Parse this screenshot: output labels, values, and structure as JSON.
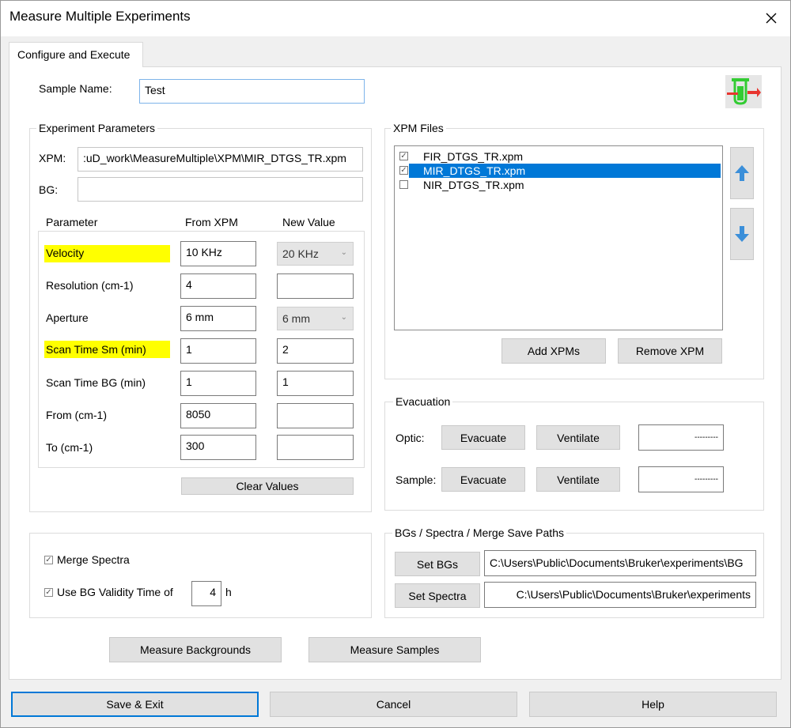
{
  "window": {
    "title": "Measure Multiple Experiments"
  },
  "tabs": [
    {
      "label": "Configure and Execute"
    }
  ],
  "sample": {
    "label": "Sample Name:",
    "value": "Test"
  },
  "experiment": {
    "group_title": "Experiment Parameters",
    "xpm_label": "XPM:",
    "xpm_value": ":uD_work\\MeasureMultiple\\XPM\\MIR_DTGS_TR.xpm",
    "bg_label": "BG:",
    "bg_value": "",
    "headers": {
      "parameter": "Parameter",
      "from": "From XPM",
      "new": "New Value"
    },
    "rows": [
      {
        "name": "Velocity",
        "from": "10 KHz",
        "new": "20 KHz"
      },
      {
        "name": "Resolution (cm-1)",
        "from": "4",
        "new": ""
      },
      {
        "name": "Aperture",
        "from": "6 mm",
        "new": "6 mm"
      },
      {
        "name": "Scan Time Sm (min)",
        "from": "1",
        "new": "2"
      },
      {
        "name": "Scan Time BG (min)",
        "from": "1",
        "new": "1"
      },
      {
        "name": "From (cm-1)",
        "from": "8050",
        "new": ""
      },
      {
        "name": "To (cm-1)",
        "from": "300",
        "new": ""
      }
    ],
    "clear_label": "Clear Values"
  },
  "xpm_files": {
    "group_title": "XPM Files",
    "items": [
      {
        "name": "FIR_DTGS_TR.xpm",
        "checked": true
      },
      {
        "name": "MIR_DTGS_TR.xpm",
        "checked": true
      },
      {
        "name": "NIR_DTGS_TR.xpm",
        "checked": false
      }
    ],
    "add_label": "Add XPMs",
    "remove_label": "Remove XPM"
  },
  "evacuation": {
    "group_title": "Evacuation",
    "optic_label": "Optic:",
    "sample_label": "Sample:",
    "evacuate_label": "Evacuate",
    "ventilate_label": "Ventilate",
    "optic_status": "---------",
    "sample_status": "---------"
  },
  "options": {
    "merge_label": "Merge Spectra",
    "validity_label": "Use BG Validity Time of",
    "validity_value": "4",
    "validity_unit": "h"
  },
  "paths": {
    "group_title": "BGs / Spectra / Merge Save Paths",
    "set_bgs_label": "Set BGs",
    "bgs_path": "C:\\Users\\Public\\Documents\\Bruker\\experiments\\BG",
    "set_spectra_label": "Set Spectra",
    "spectra_path": "C:\\Users\\Public\\Documents\\Bruker\\experiments"
  },
  "actions": {
    "measure_bg_label": "Measure Backgrounds",
    "measure_samples_label": "Measure Samples"
  },
  "footer": {
    "save_label": "Save & Exit",
    "cancel_label": "Cancel",
    "help_label": "Help"
  },
  "colors": {
    "highlight": "#ffff00",
    "selection": "#0078d7",
    "arrow": "#3b8fd9",
    "icon_green": "#33cc33",
    "icon_red": "#e8352f"
  },
  "icons": {
    "close": "close-icon",
    "logo": "experiment-flask-icon",
    "up": "arrow-up-icon",
    "down": "arrow-down-icon"
  }
}
